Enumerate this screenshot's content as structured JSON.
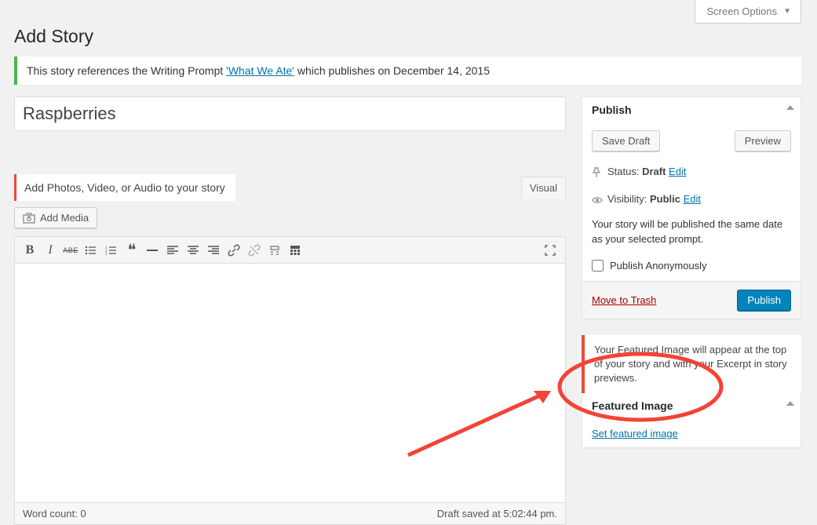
{
  "screenOptions": "Screen Options",
  "pageTitle": "Add Story",
  "notice": {
    "prefix": "This story references the Writing Prompt ",
    "linkText": "'What We Ate'",
    "suffix": " which publishes on December 14, 2015"
  },
  "titleField": {
    "value": "Raspberries"
  },
  "mediaHint": "Add Photos, Video, or Audio to your story",
  "visualTab": "Visual",
  "addMedia": "Add Media",
  "toolbar": {
    "bold": "B",
    "italic": "I",
    "strike": "ABE"
  },
  "wordCount": {
    "label": "Word count: ",
    "value": "0"
  },
  "draftSaved": "Draft saved at 5:02:44 pm.",
  "publishBox": {
    "title": "Publish",
    "saveDraft": "Save Draft",
    "preview": "Preview",
    "statusLabel": "Status: ",
    "statusValue": "Draft",
    "statusEdit": "Edit",
    "visibilityLabel": "Visibility: ",
    "visibilityValue": "Public",
    "visibilityEdit": "Edit",
    "dateText": "Your story will be published the same date as your selected prompt.",
    "anonCheckbox": "Publish Anonymously",
    "trash": "Move to Trash",
    "publishBtn": "Publish"
  },
  "featuredHint": "Your Featured Image will appear at the top of your story and with your Excerpt in story previews.",
  "featuredBox": {
    "title": "Featured Image",
    "setLink": "Set featured image"
  }
}
